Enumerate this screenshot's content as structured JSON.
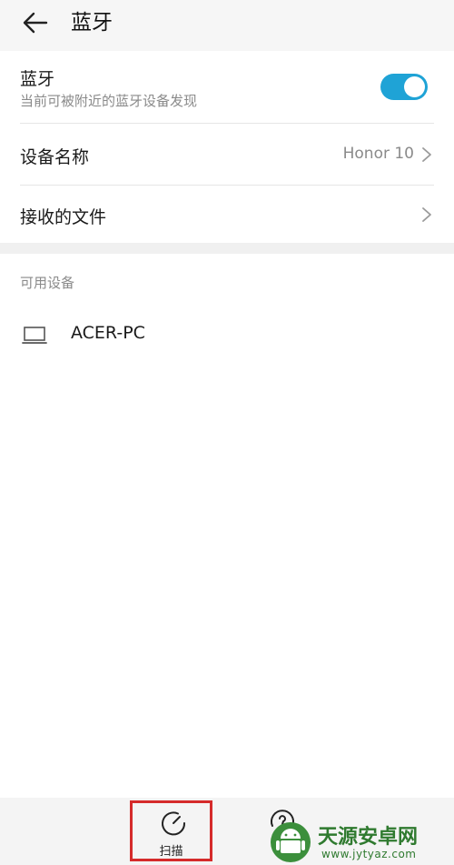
{
  "header": {
    "title": "蓝牙"
  },
  "bluetooth": {
    "label": "蓝牙",
    "subtitle": "当前可被附近的蓝牙设备发现",
    "enabled": true,
    "accent_color": "#1fa3d6"
  },
  "settings": {
    "device_name_label": "设备名称",
    "device_name_value": "Honor 10",
    "received_files_label": "接收的文件"
  },
  "available": {
    "section_title": "可用设备",
    "devices": [
      {
        "name": "ACER-PC",
        "icon": "laptop-icon"
      }
    ]
  },
  "bottom_bar": {
    "scan_label": "扫描",
    "scan_icon": "refresh-icon",
    "highlight_color": "#d52b2b"
  },
  "watermark": {
    "title": "天源安卓网",
    "url": "www.jytyaz.com"
  }
}
